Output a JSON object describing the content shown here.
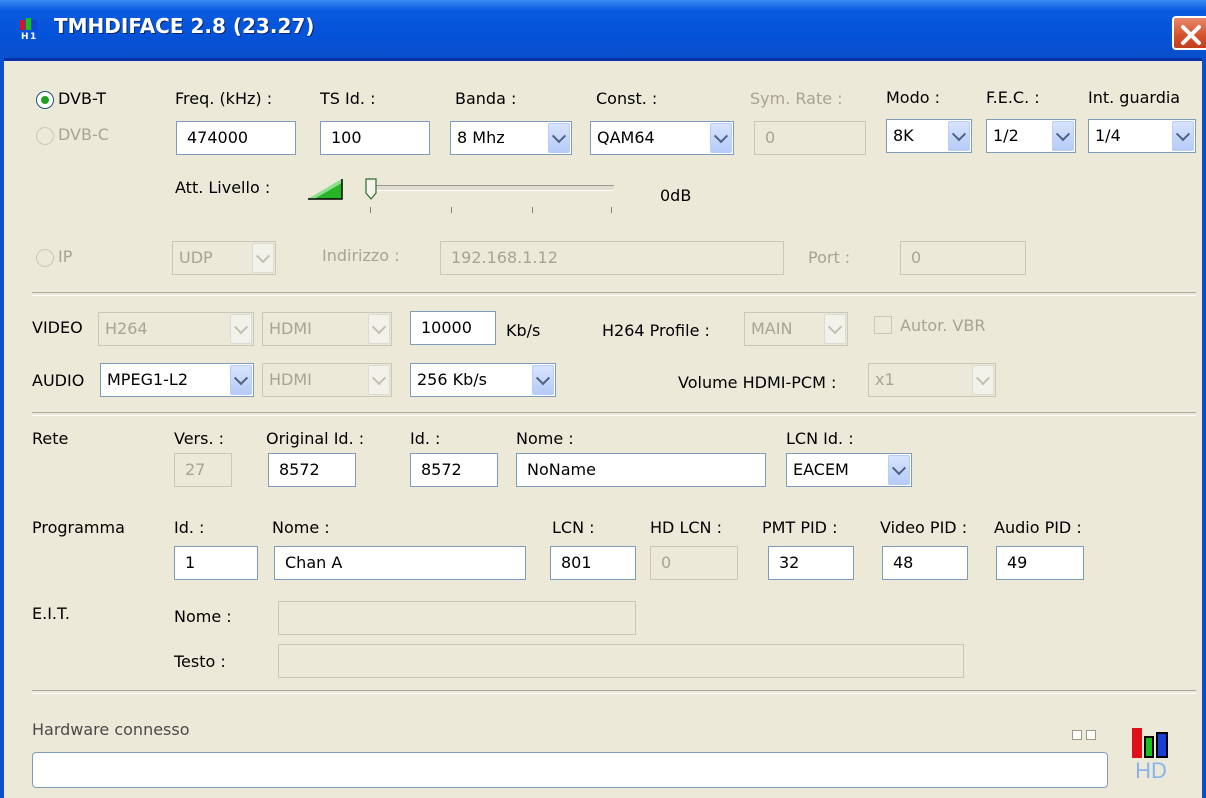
{
  "window": {
    "title": "TMHDIFACE 2.8 (23.27)"
  },
  "modulation": {
    "dvbt_label": "DVB-T",
    "dvbc_label": "DVB-C",
    "freq_label": "Freq. (kHz) :",
    "freq_value": "474000",
    "tsid_label": "TS Id. :",
    "tsid_value": "100",
    "banda_label": "Banda :",
    "banda_value": "8 Mhz",
    "const_label": "Const. :",
    "const_value": "QAM64",
    "symrate_label": "Sym. Rate :",
    "symrate_value": "0",
    "modo_label": "Modo :",
    "modo_value": "8K",
    "fec_label": "F.E.C. :",
    "fec_value": "1/2",
    "guard_label": "Int. guardia",
    "guard_value": "1/4",
    "att_label": "Att. Livello :",
    "att_value": "0dB",
    "att_level": 0
  },
  "ip": {
    "label": "IP",
    "protocol": "UDP",
    "address_label": "Indirizzo :",
    "address_value": "192.168.1.12",
    "port_label": "Port :",
    "port_value": "0"
  },
  "av": {
    "video_label": "VIDEO",
    "video_codec": "H264",
    "video_source": "HDMI",
    "bitrate_value": "10000",
    "bitrate_unit": "Kb/s",
    "profile_label": "H264 Profile :",
    "profile_value": "MAIN",
    "vbr_label": "Autor. VBR",
    "audio_label": "AUDIO",
    "audio_codec": "MPEG1-L2",
    "audio_source": "HDMI",
    "audio_bitrate": "256 Kb/s",
    "volume_label": "Volume HDMI-PCM :",
    "volume_value": "x1"
  },
  "network": {
    "label": "Rete",
    "vers_label": "Vers. :",
    "vers_value": "27",
    "origid_label": "Original Id. :",
    "origid_value": "8572",
    "id_label": "Id. :",
    "id_value": "8572",
    "name_label": "Nome :",
    "name_value": "NoName",
    "lcnid_label": "LCN Id. :",
    "lcnid_value": "EACEM"
  },
  "program": {
    "label": "Programma",
    "id_label": "Id. :",
    "id_value": "1",
    "name_label": "Nome :",
    "name_value": "Chan A",
    "lcn_label": "LCN :",
    "lcn_value": "801",
    "hdlcn_label": "HD LCN :",
    "hdlcn_value": "0",
    "pmt_label": "PMT PID :",
    "pmt_value": "32",
    "video_pid_label": "Video PID :",
    "video_pid_value": "48",
    "audio_pid_label": "Audio PID :",
    "audio_pid_value": "49"
  },
  "eit": {
    "label": "E.I.T.",
    "name_label": "Nome :",
    "name_value": "",
    "text_label": "Testo :",
    "text_value": ""
  },
  "status": {
    "hardware_label": "Hardware connesso",
    "progress": 0,
    "logo_text": "HD"
  },
  "colors": {
    "titlebar": "#0453d8",
    "logo_red": "#e0101a",
    "logo_green": "#18c018",
    "logo_blue": "#1840d8"
  }
}
